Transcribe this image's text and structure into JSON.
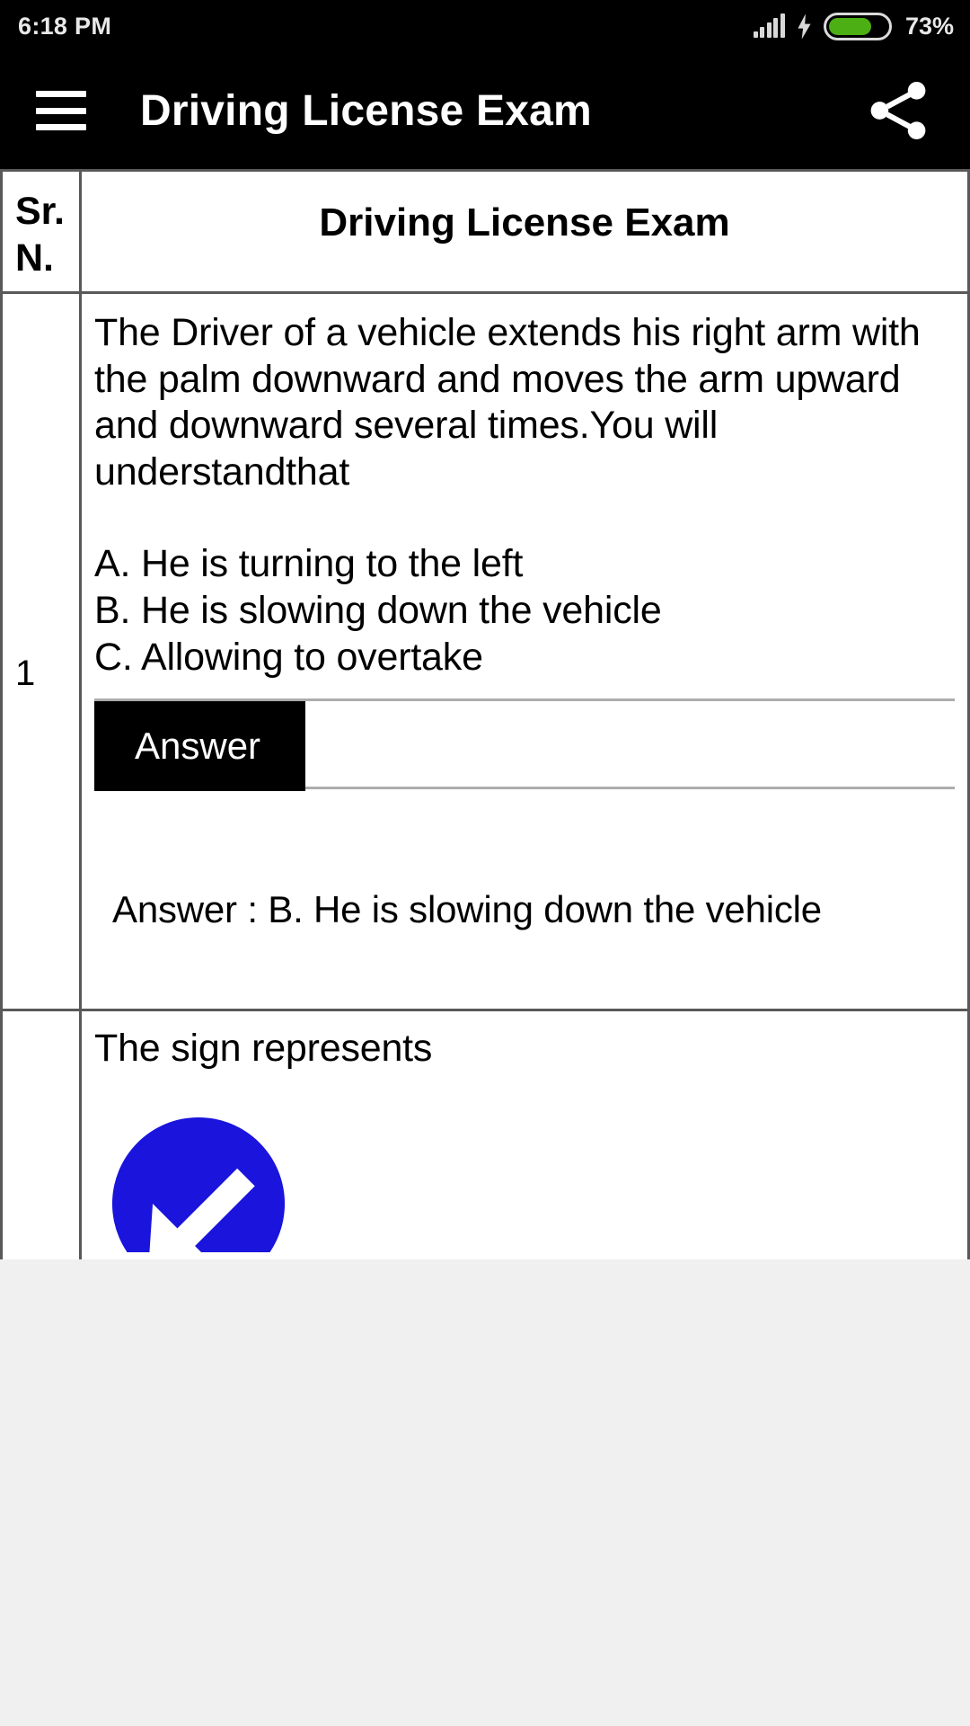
{
  "status_bar": {
    "time": "6:18 PM",
    "battery_percent": "73%",
    "battery_color": "#4caf14",
    "signal_icon": "cellular-signal-icon",
    "charging_icon": "charging-bolt-icon",
    "battery_icon": "battery-icon"
  },
  "app_bar": {
    "menu_icon": "hamburger-menu-icon",
    "title": "Driving License Exam",
    "share_icon": "share-icon"
  },
  "table": {
    "headers": {
      "sr_no": "Sr. N.",
      "title": "Driving License Exam"
    },
    "rows": [
      {
        "sr_no": "1",
        "question": "The Driver of a vehicle extends his right arm with the palm downward and moves the arm upward and downward several times.You will understandthat",
        "options": [
          "A. He is turning to the left",
          "B. He is slowing down the vehicle",
          "C. Allowing to overtake"
        ],
        "answer_button_label": "Answer",
        "answer_reveal": "Answer : B. He is slowing down the vehicle"
      },
      {
        "sr_no": "",
        "question": "The sign represents",
        "sign_icon": "blue-circular-left-turn-arrow-sign",
        "sign_colors": {
          "circle": "#1A14DC",
          "arrow": "#ffffff"
        }
      }
    ]
  }
}
